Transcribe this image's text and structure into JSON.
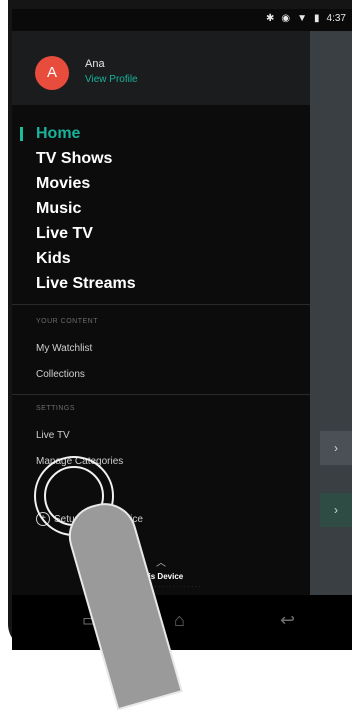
{
  "status_bar": {
    "time": "4:37"
  },
  "profile": {
    "avatar_letter": "A",
    "name": "Ana",
    "link": "View Profile"
  },
  "main_nav": [
    "Home",
    "TV Shows",
    "Movies",
    "Music",
    "Live TV",
    "Kids",
    "Live Streams"
  ],
  "your_content": {
    "title": "YOUR CONTENT",
    "items": [
      "My Watchlist",
      "Collections"
    ]
  },
  "settings": {
    "title": "SETTINGS",
    "items": [
      "Live TV",
      "Manage Categories"
    ]
  },
  "setup": {
    "label": "Setup a new Device"
  },
  "device_panel": {
    "label": "This Device"
  },
  "right_cards": [
    "›",
    "›"
  ],
  "colors": {
    "accent": "#1abc9c",
    "avatar": "#e74c3c"
  }
}
